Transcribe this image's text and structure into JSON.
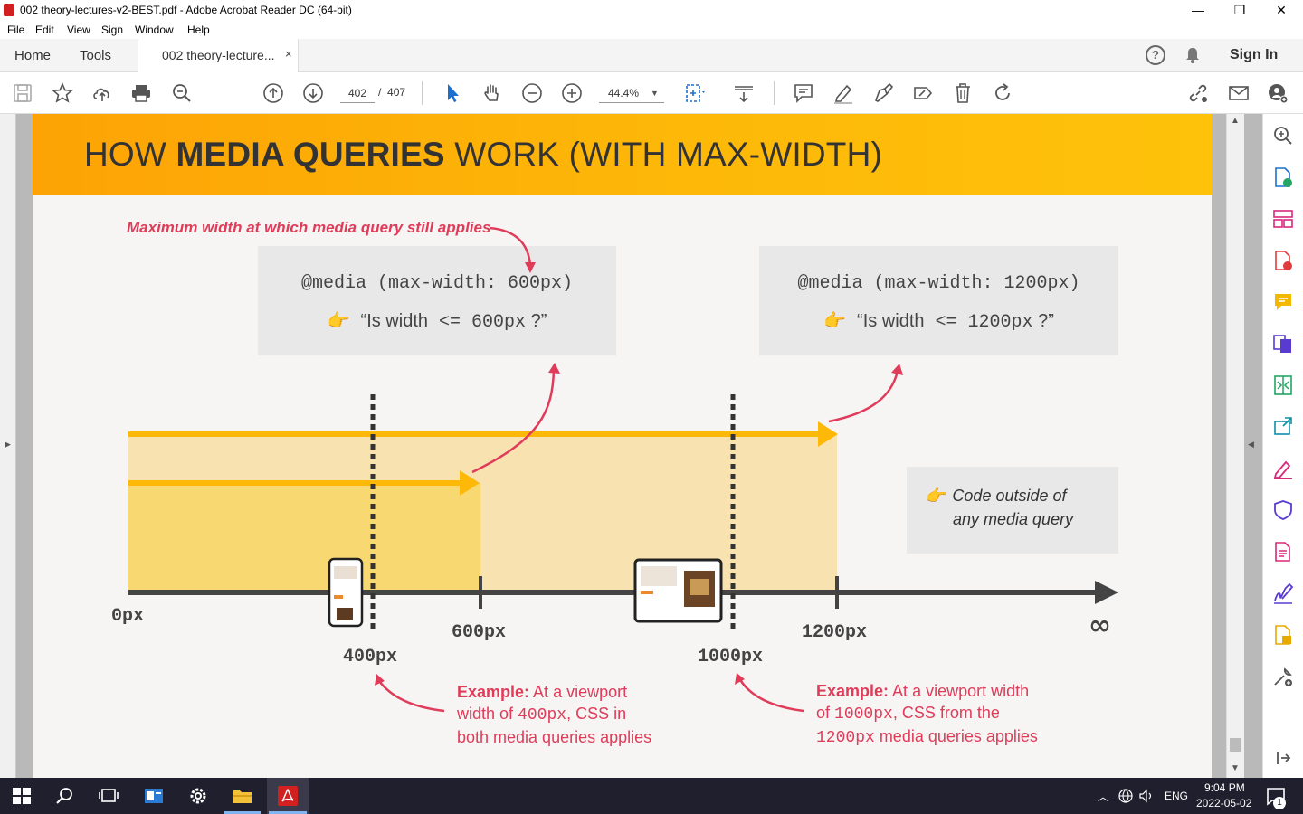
{
  "window": {
    "title": "002 theory-lectures-v2-BEST.pdf - Adobe Acrobat Reader DC (64-bit)",
    "minimize": "—",
    "restore": "❐",
    "close": "✕"
  },
  "menu": [
    "File",
    "Edit",
    "View",
    "Sign",
    "Window",
    "Help"
  ],
  "tabs": {
    "home": "Home",
    "tools": "Tools",
    "document": "002 theory-lecture...",
    "close": "×",
    "help": "?",
    "sign_in": "Sign In"
  },
  "toolbar": {
    "page_current": "402",
    "page_total": "407",
    "page_sep": "/",
    "zoom": "44.4%"
  },
  "slide": {
    "title_prefix": "HOW ",
    "title_bold": "MEDIA QUERIES",
    "title_suffix": " WORK (WITH MAX-WIDTH)",
    "annotation_top": "Maximum width at which media query still applies",
    "box1": {
      "line1": "@media (max-width: 600px)",
      "line2_pre": "“Is width",
      "line2_op": " <= 600px",
      "line2_post": " ?”"
    },
    "box2": {
      "line1": "@media (max-width: 1200px)",
      "line2_pre": "“Is width",
      "line2_op": " <= 1200px",
      "line2_post": " ?”"
    },
    "box3": {
      "line1": "Code outside of",
      "line2": "any media query"
    },
    "axis": {
      "start": "0px",
      "l400": "400px",
      "l600": "600px",
      "l1000": "1000px",
      "l1200": "1200px",
      "end": "∞"
    },
    "example1": {
      "bold": "Example:",
      "t1": " At a viewport",
      "t2a": "width of ",
      "t2b": "400px",
      "t2c": ", CSS in",
      "t3": "both media queries applies"
    },
    "example2": {
      "bold": "Example:",
      "t1": " At a viewport width",
      "t2a": "of ",
      "t2b": "1000px",
      "t2c": ", CSS from the",
      "t3a": "1200px",
      "t3b": " media queries applies"
    }
  },
  "taskbar": {
    "lang": "ENG",
    "time": "9:04 PM",
    "date": "2022-05-02",
    "notifications": "1"
  }
}
